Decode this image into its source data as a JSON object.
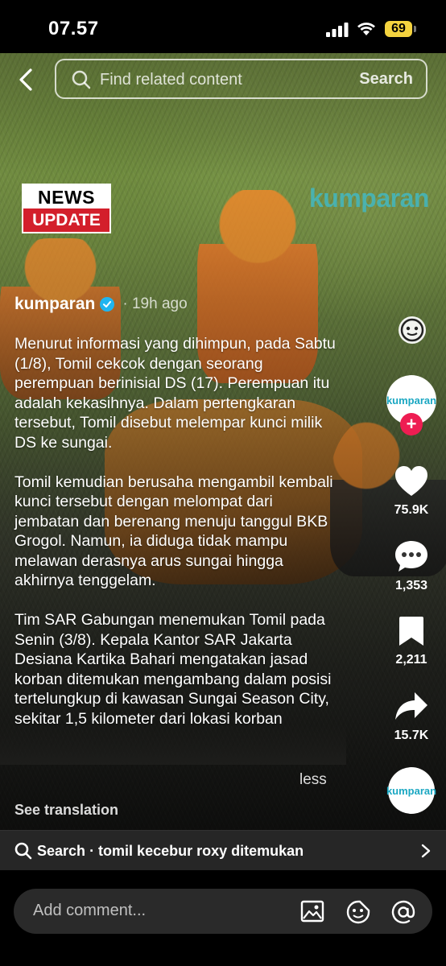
{
  "status_bar": {
    "time": "07.57",
    "battery": "69"
  },
  "search": {
    "placeholder": "Find related content",
    "button": "Search"
  },
  "video_overlay": {
    "badge_top": "NEWS",
    "badge_bottom": "UPDATE",
    "watermark": "kumparan"
  },
  "post": {
    "author": "kumparan",
    "posted": "· 19h ago",
    "caption_paragraphs": [
      "Menurut informasi yang dihimpun, pada Sabtu (1/8), Tomil cekcok dengan seorang perempuan berinisial DS (17). Perempuan itu adalah kekasihnya. Dalam pertengkaran tersebut, Tomil disebut melempar kunci milik DS ke sungai.",
      "Tomil kemudian berusaha mengambil kembali kunci tersebut dengan melompat dari jembatan dan berenang menuju tanggul BKB Grogol. Namun, ia diduga tidak mampu melawan derasnya arus sungai hingga akhirnya tenggelam.",
      "Tim SAR Gabungan menemukan Tomil pada Senin (3/8). Kepala Kantor SAR Jakarta Desiana Kartika Bahari mengatakan jasad korban ditemukan mengambang dalam posisi tertelungkup di kawasan Sungai Season City, sekitar 1,5 kilometer dari lokasi korban"
    ],
    "less_label": "less",
    "translation_label": "See translation"
  },
  "rail": {
    "avatar_label": "kumparan",
    "likes": "75.9K",
    "comments": "1,353",
    "saves": "2,211",
    "shares": "15.7K",
    "sound_label": "kumparan"
  },
  "related_search": {
    "prefix": "Search",
    "query": "· tomil kecebur roxy ditemukan"
  },
  "comment": {
    "placeholder": "Add comment..."
  },
  "colors": {
    "accent_red": "#ee1d52",
    "badge_red": "#d31f2b",
    "battery": "#f4d33f"
  }
}
